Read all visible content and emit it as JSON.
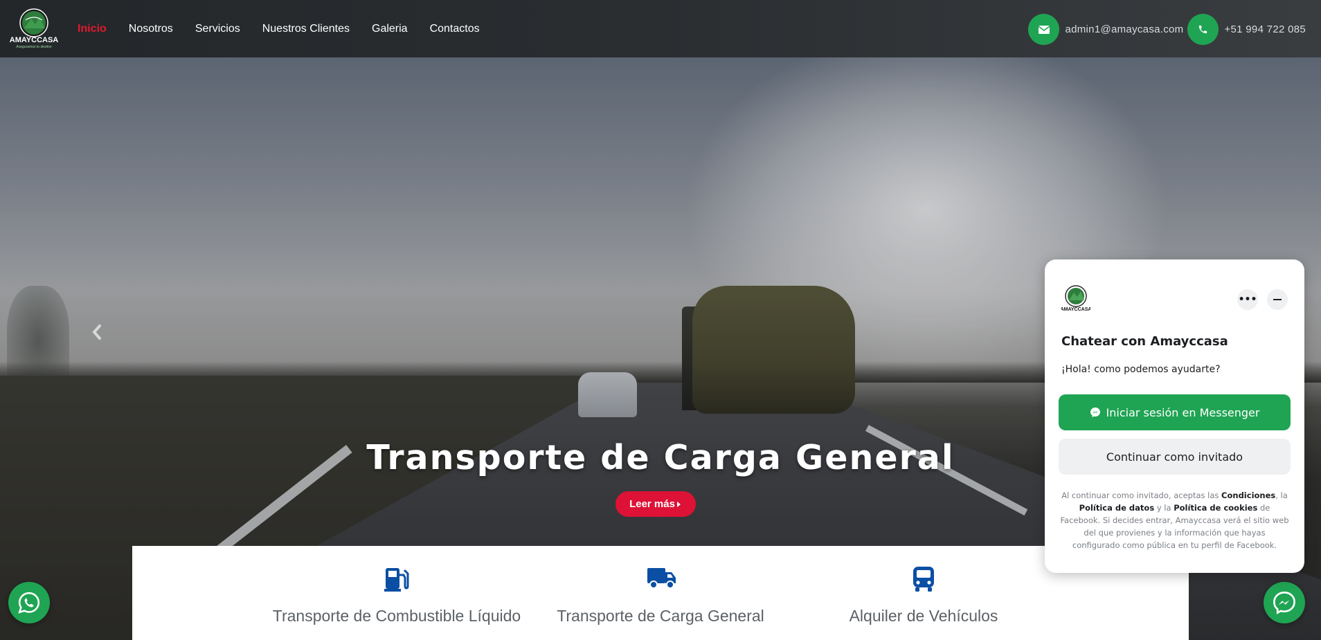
{
  "brand": {
    "logo_text": "AMAYCCASA",
    "logo_tagline": "Aseguramos tu destino"
  },
  "nav": {
    "items": [
      {
        "label": "Inicio",
        "active": true
      },
      {
        "label": "Nosotros",
        "active": false
      },
      {
        "label": "Servicios",
        "active": false
      },
      {
        "label": "Nuestros Clientes",
        "active": false
      },
      {
        "label": "Galeria",
        "active": false
      },
      {
        "label": "Contactos",
        "active": false
      }
    ]
  },
  "contact": {
    "email": "admin1@amaycasa.com",
    "phone": "+51 994 722 085",
    "icon_color": "#1fa453"
  },
  "hero": {
    "title": "Transporte de Carga General",
    "button": "Leer más",
    "prev_arrow": "‹"
  },
  "services": [
    {
      "icon": "fuel-pump-icon",
      "label": "Transporte de Combustible Líquido"
    },
    {
      "icon": "truck-icon",
      "label": "Transporte de Carga General"
    },
    {
      "icon": "bus-icon",
      "label": "Alquiler de Vehículos"
    }
  ],
  "chat": {
    "title": "Chatear con Amayccasa",
    "greeting": "¡Hola! como podemos ayudarte?",
    "messenger_button": "Iniciar sesión en Messenger",
    "guest_button": "Continuar como invitado",
    "more_label": "•••",
    "legal": {
      "p1": "Al continuar como invitado, aceptas las ",
      "b1": "Condiciones",
      "p2": ", la ",
      "b2": "Política de datos",
      "p3": " y la ",
      "b3": "Política de cookies",
      "p4": " de Facebook. Si decides entrar, Amayccasa verá el sitio web del que provienes y la información que hayas configurado como pública en tu perfil de Facebook."
    }
  },
  "colors": {
    "accent_red": "#dd1236",
    "nav_active": "#e3182d",
    "green": "#1fa453",
    "service_icon": "#0a4fa3"
  }
}
